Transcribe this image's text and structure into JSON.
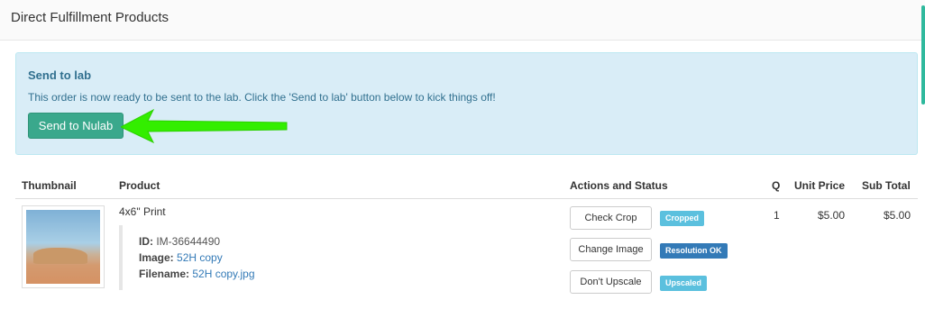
{
  "panel": {
    "title": "Direct Fulfillment Products"
  },
  "alert": {
    "title": "Send to lab",
    "text": "This order is now ready to be sent to the lab. Click the 'Send to lab' button below to kick things off!",
    "button_label": "Send to Nulab"
  },
  "table": {
    "headers": {
      "thumbnail": "Thumbnail",
      "product": "Product",
      "actions": "Actions and Status",
      "q": "Q",
      "unit_price": "Unit Price",
      "sub_total": "Sub Total"
    },
    "row": {
      "product_name": "4x6\" Print",
      "id_label": "ID:",
      "id_value": "IM-36644490",
      "image_label": "Image:",
      "image_value": "52H copy",
      "filename_label": "Filename:",
      "filename_value": "52H copy.jpg",
      "actions": [
        {
          "label": "Check Crop",
          "status": "Cropped",
          "status_color": "#5bc0de"
        },
        {
          "label": "Change Image",
          "status": "Resolution OK",
          "status_color": "#337ab7"
        },
        {
          "label": "Don't Upscale",
          "status": "Upscaled",
          "status_color": "#5bc0de"
        }
      ],
      "q": "1",
      "unit_price": "$5.00",
      "sub_total": "$5.00"
    }
  },
  "colors": {
    "accent": "#3aa88c",
    "alert_bg": "#d9edf7",
    "annotation_arrow": "#33ee00"
  }
}
